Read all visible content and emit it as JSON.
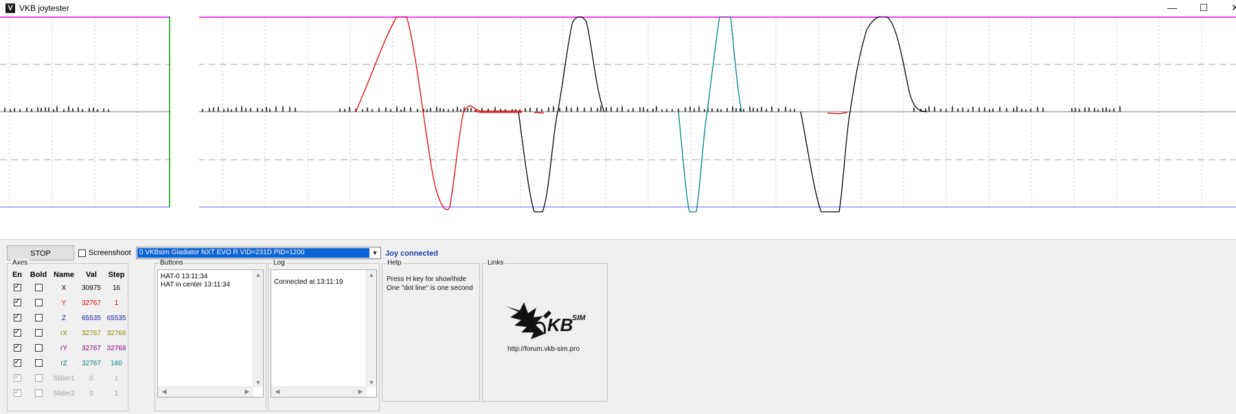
{
  "window": {
    "title": "VKB joytester",
    "minimize_icon": "minimize-icon",
    "maximize_icon": "maximize-icon",
    "close_icon": "close-icon"
  },
  "toolbar": {
    "stop_label": "STOP",
    "screenshot_label": "Screenshoot",
    "screenshot_checked": false,
    "device_selected": "0  VKBsim Gladiator NXT EVO  R   VID=231D PID=1200",
    "status": "Joy connected"
  },
  "axes": {
    "title": "Axes",
    "headers": {
      "en": "En",
      "bold": "Bold",
      "name": "Name",
      "val": "Val",
      "step": "Step"
    },
    "rows": [
      {
        "name": "X",
        "val": "30975",
        "step": "16",
        "en": true,
        "bold": false,
        "color": "#000000",
        "enabled": true
      },
      {
        "name": "Y",
        "val": "32767",
        "step": "1",
        "en": true,
        "bold": false,
        "color": "#e00000",
        "enabled": true
      },
      {
        "name": "Z",
        "val": "65535",
        "step": "65535",
        "en": true,
        "bold": false,
        "color": "#1a1aa0",
        "enabled": true
      },
      {
        "name": "rX",
        "val": "32767",
        "step": "32768",
        "en": true,
        "bold": false,
        "color": "#8a8a00",
        "enabled": true
      },
      {
        "name": "rY",
        "val": "32767",
        "step": "32768",
        "en": true,
        "bold": false,
        "color": "#8a008a",
        "enabled": true
      },
      {
        "name": "rZ",
        "val": "32767",
        "step": "160",
        "en": true,
        "bold": false,
        "color": "#008080",
        "enabled": true
      },
      {
        "name": "Slider1",
        "val": "0",
        "step": "1",
        "en": true,
        "bold": false,
        "color": "#a0a0a0",
        "enabled": false
      },
      {
        "name": "Slider2",
        "val": "0",
        "step": "1",
        "en": true,
        "bold": false,
        "color": "#a0a0a0",
        "enabled": false
      }
    ]
  },
  "buttons_panel": {
    "title": "Buttons",
    "lines": [
      "HAT-0 13:11:34",
      "HAT in center 13:11:34"
    ]
  },
  "log_panel": {
    "title": "Log",
    "lines": [
      "Connected at 13:11:19"
    ]
  },
  "help_panel": {
    "title": "Help",
    "line1": "Press H key for show\\hide",
    "line2": "One \"dot line\" is one second"
  },
  "links_panel": {
    "title": "Links",
    "logo_text": "KB",
    "logo_sup": "SIM",
    "url": "http://forum.vkb-sim.pro"
  },
  "colors": {
    "top_limit_line": "#ff00ff",
    "center_line": "#a0a0a0",
    "axis_x": "#000000",
    "axis_y": "#e00000",
    "axis_rz": "#008080",
    "cursor_line": "#00a000",
    "bottom_limit_line": "#6060ff"
  }
}
